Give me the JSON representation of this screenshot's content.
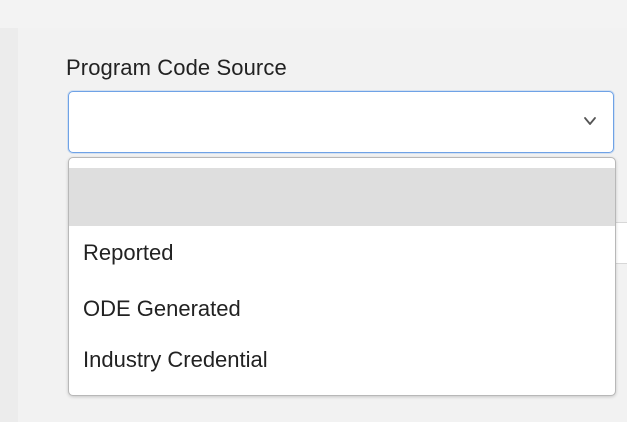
{
  "field": {
    "label": "Program Code Source",
    "selected_value": ""
  },
  "dropdown": {
    "options": [
      {
        "label": "",
        "selected": true
      },
      {
        "label": "Reported",
        "selected": false
      },
      {
        "label": "ODE Generated",
        "selected": false
      },
      {
        "label": "Industry Credential",
        "selected": false
      }
    ]
  },
  "icons": {
    "select_chevron": "chevron-down-icon"
  },
  "colors": {
    "focus_border": "#6fa2e6",
    "selected_option_bg": "#dedede",
    "page_bg": "#ececec"
  }
}
